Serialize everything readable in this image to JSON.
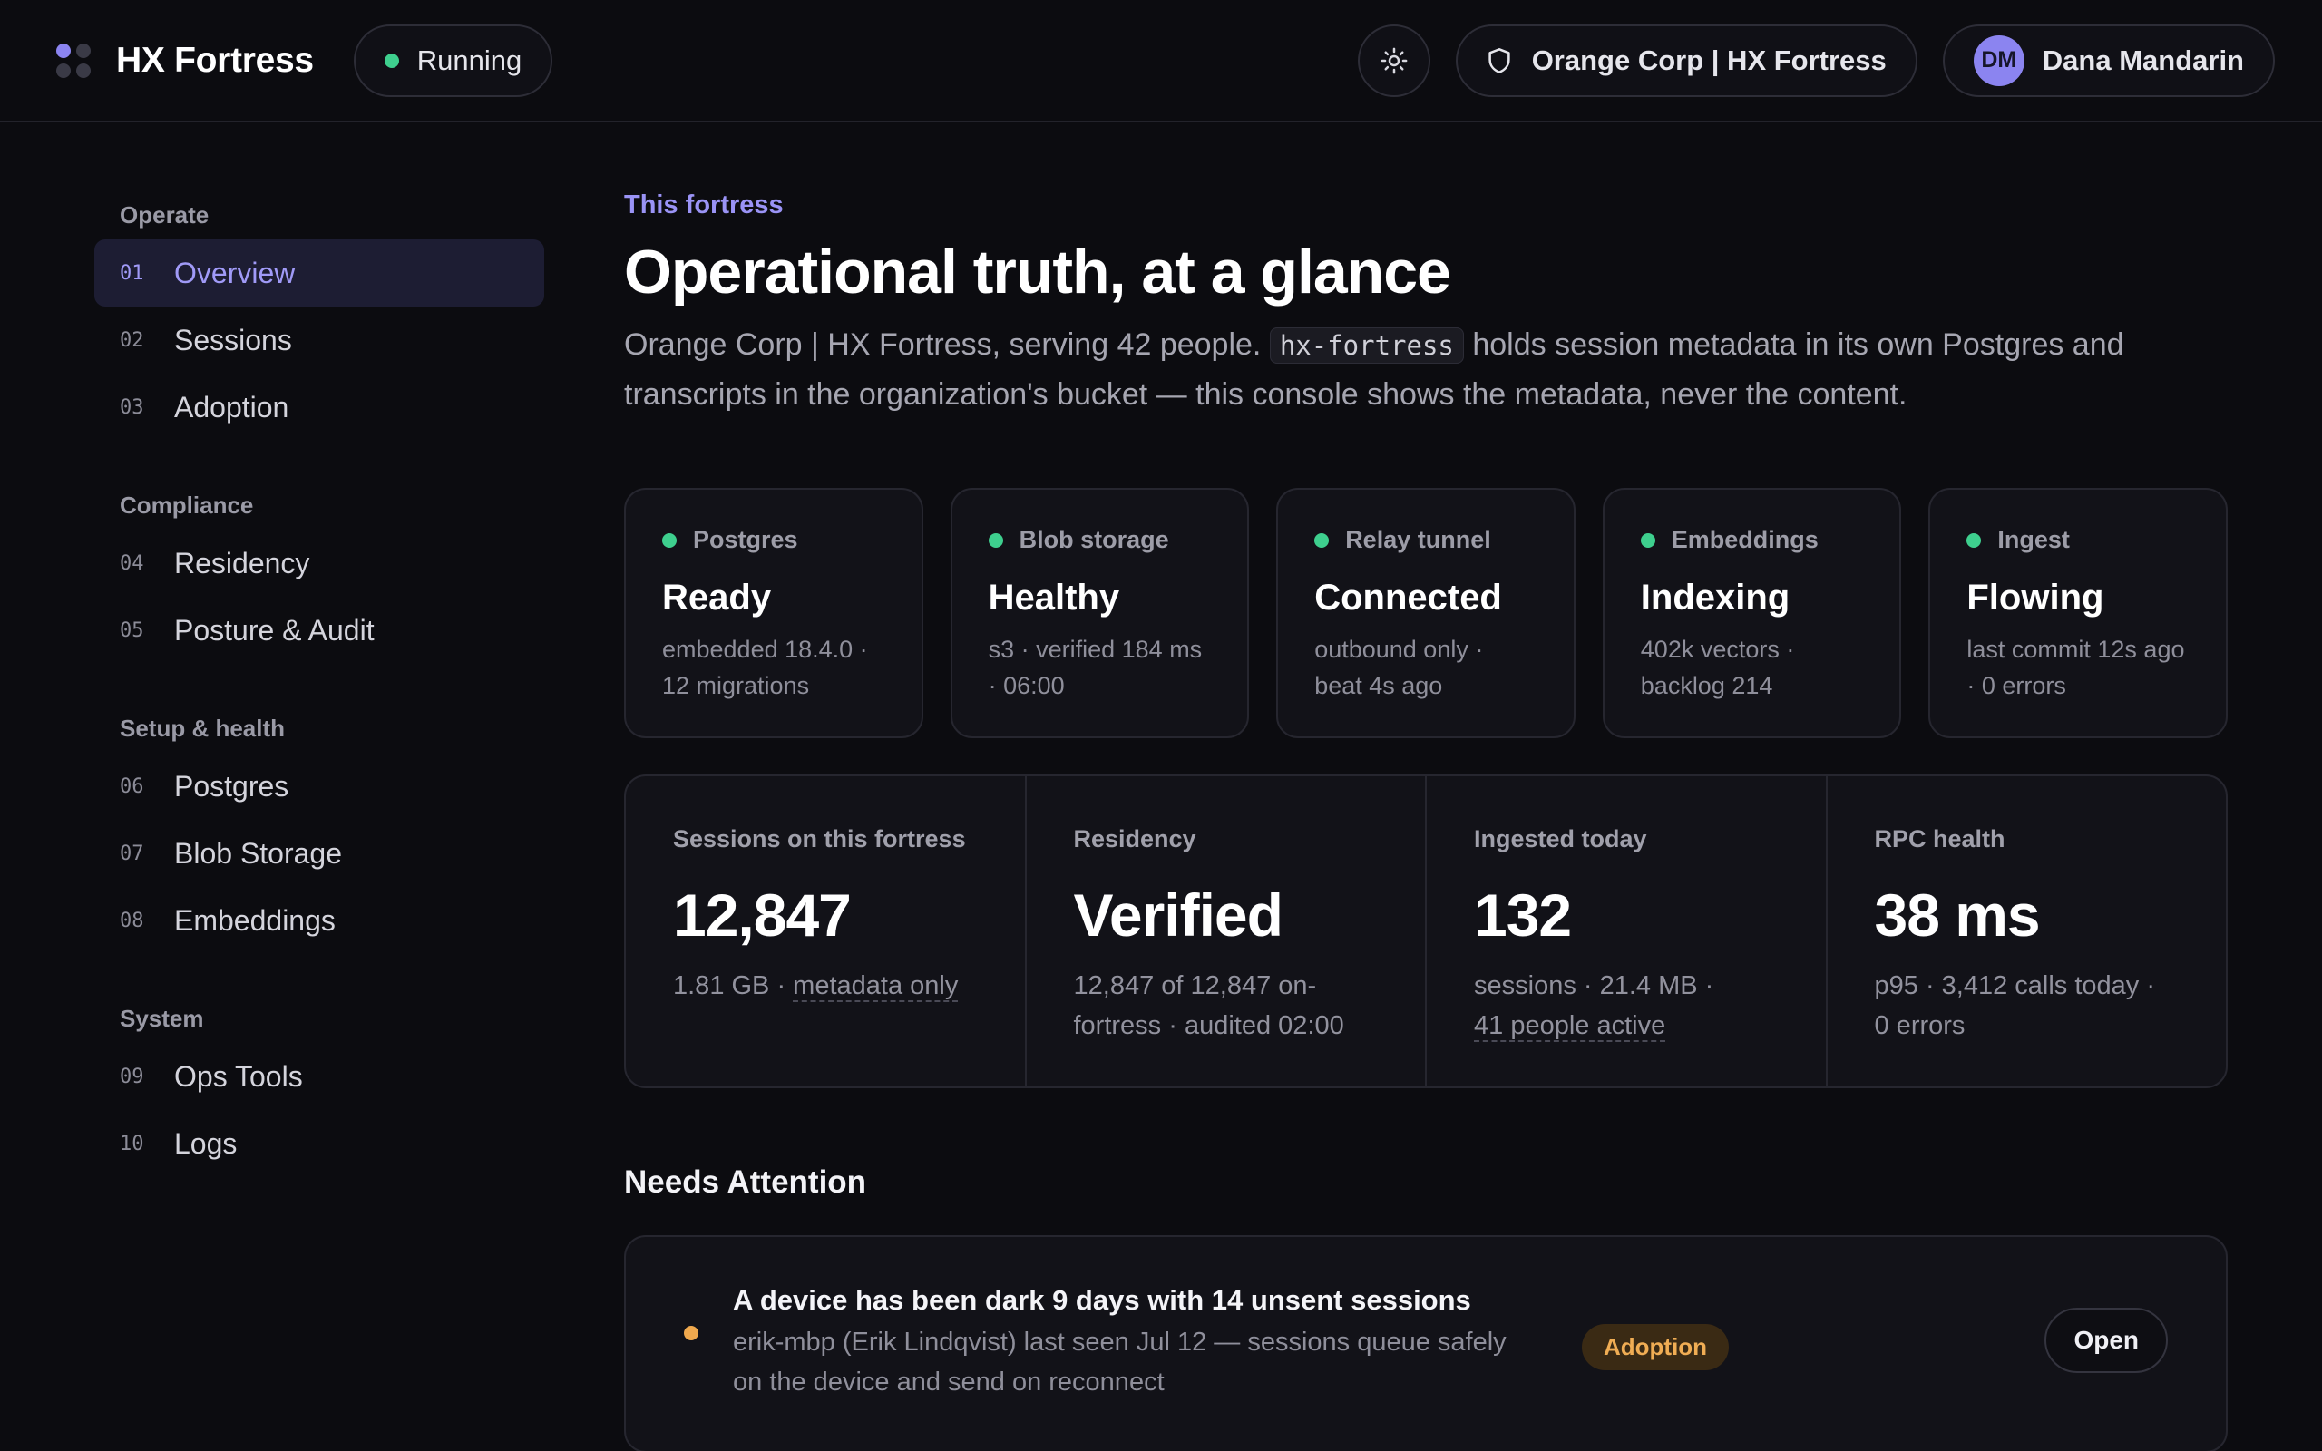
{
  "app": {
    "brand": "HX Fortress",
    "status": "Running",
    "org": "Orange Corp | HX Fortress",
    "user": {
      "initials": "DM",
      "name": "Dana Mandarin"
    },
    "theme_icon": "sun-icon"
  },
  "sidebar": {
    "groups": [
      {
        "heading": "Operate",
        "items": [
          {
            "num": "01",
            "label": "Overview",
            "active": true
          },
          {
            "num": "02",
            "label": "Sessions"
          },
          {
            "num": "03",
            "label": "Adoption"
          }
        ]
      },
      {
        "heading": "Compliance",
        "items": [
          {
            "num": "04",
            "label": "Residency"
          },
          {
            "num": "05",
            "label": "Posture & Audit"
          }
        ]
      },
      {
        "heading": "Setup & health",
        "items": [
          {
            "num": "06",
            "label": "Postgres"
          },
          {
            "num": "07",
            "label": "Blob Storage"
          },
          {
            "num": "08",
            "label": "Embeddings"
          }
        ]
      },
      {
        "heading": "System",
        "items": [
          {
            "num": "09",
            "label": "Ops Tools"
          },
          {
            "num": "10",
            "label": "Logs"
          }
        ]
      }
    ]
  },
  "main": {
    "eyebrow": "This fortress",
    "title": "Operational truth, at a glance",
    "lede_before": "Orange Corp | HX Fortress, serving 42 people. ",
    "lede_code": "hx-fortress",
    "lede_after": " holds session metadata in its own Postgres and transcripts in the organization's bucket — this console shows the metadata, never the content.",
    "health": [
      {
        "label": "Postgres",
        "value": "Ready",
        "sub1": "embedded 18.4.0 ·",
        "sub2": "12 migrations"
      },
      {
        "label": "Blob storage",
        "value": "Healthy",
        "sub1": "s3 · verified 184 ms",
        "sub2": "· 06:00"
      },
      {
        "label": "Relay tunnel",
        "value": "Connected",
        "sub1": "outbound only ·",
        "sub2": "beat 4s ago"
      },
      {
        "label": "Embeddings",
        "value": "Indexing",
        "sub1": "402k vectors ·",
        "sub2": "backlog 214"
      },
      {
        "label": "Ingest",
        "value": "Flowing",
        "sub1": "last commit 12s ago",
        "sub2": "· 0 errors"
      }
    ],
    "stats": {
      "sessions": {
        "label": "Sessions on this fortress",
        "value": "12,847",
        "sub_a": "1.81 GB · ",
        "sub_b": "metadata only"
      },
      "residency": {
        "label": "Residency",
        "value": "Verified",
        "sub1": "12,847 of 12,847 on-",
        "sub2": "fortress · audited 02:00"
      },
      "ingested": {
        "label": "Ingested today",
        "value": "132",
        "sub1": "sessions · 21.4 MB ·",
        "sub2": "41 people active"
      },
      "rpc": {
        "label": "RPC health",
        "value": "38 ms",
        "sub1": "p95 · 3,412 calls today ·",
        "sub2": "0 errors"
      }
    },
    "attention": {
      "heading": "Needs Attention",
      "items": [
        {
          "title": "A device has been dark 9 days with 14 unsent sessions",
          "desc1": "erik-mbp (Erik Lindqvist) last seen Jul 12 — sessions queue safely",
          "desc2": "on the device and send on reconnect",
          "tag": "Adoption",
          "action": "Open"
        }
      ]
    }
  },
  "colors": {
    "accent": "#8b84f0",
    "ok": "#3ecf8e",
    "warn": "#f0a94e"
  }
}
